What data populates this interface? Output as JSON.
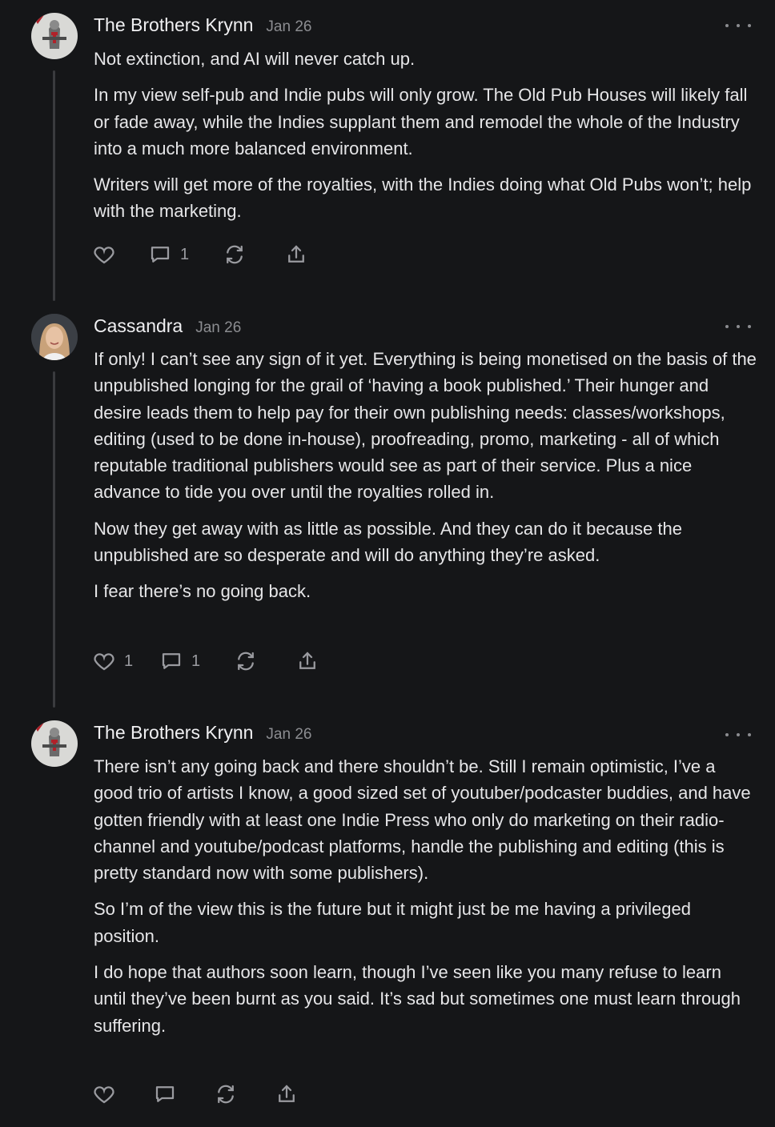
{
  "comments": [
    {
      "author": "The Brothers Krynn",
      "date": "Jan 26",
      "avatar": "knight-avatar",
      "paragraphs": [
        "Not extinction, and AI will never catch up.",
        "In my view self-pub and Indie pubs will only grow. The Old Pub Houses will likely fall or fade away, while the Indies supplant them and remodel the whole of the Industry into a much more balanced environment.",
        "Writers will get more of the royalties, with the Indies doing what Old Pubs won’t; help with the marketing."
      ],
      "likes": "",
      "replies": "1"
    },
    {
      "author": "Cassandra",
      "date": "Jan 26",
      "avatar": "woman-avatar",
      "paragraphs": [
        "If only! I can’t see any sign of it yet. Everything is being monetised on the basis of the unpublished longing for the grail of ‘having a book published.’ Their hunger and desire leads them to help pay for their own publishing needs: classes/workshops, editing (used to be done in-house), proofreading, promo, marketing - all of which reputable traditional publishers would see as part of their service. Plus a nice advance to tide you over until the royalties rolled in.",
        "Now they get away with as little as possible. And they can do it because the unpublished are so desperate and will do anything they’re asked.",
        "I fear there’s no going back."
      ],
      "likes": "1",
      "replies": "1"
    },
    {
      "author": "The Brothers Krynn",
      "date": "Jan 26",
      "avatar": "knight-avatar",
      "paragraphs": [
        "There isn’t any going back and there shouldn’t be. Still I remain optimistic, I’ve a good trio of artists I know, a good sized set of youtuber/podcaster buddies, and have gotten friendly with at least one Indie Press who only do marketing on their radio-channel and youtube/podcast platforms, handle the publishing and editing (this is pretty standard now with some publishers).",
        "So I’m of the view this is the future but it might just be me having a privileged position.",
        "I do hope that authors soon learn, though I’ve seen like you many refuse to learn until they’ve been burnt as you said. It’s sad but sometimes one must learn through suffering."
      ],
      "likes": "",
      "replies": ""
    }
  ],
  "colors": {
    "background": "#151618",
    "text": "#e6e6e8",
    "muted": "#8c8d91",
    "thread_line": "#3a3b3e"
  }
}
